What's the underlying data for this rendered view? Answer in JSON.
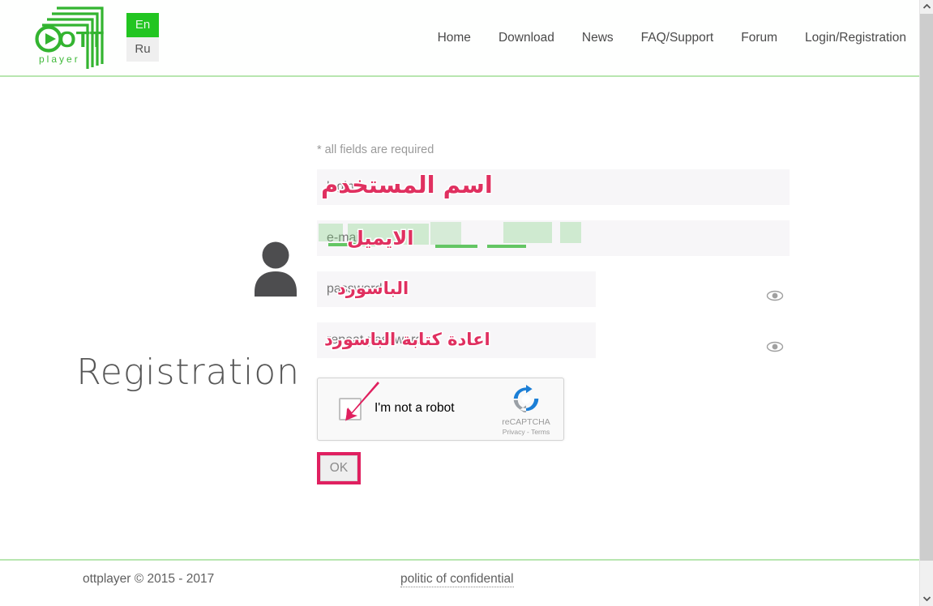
{
  "header": {
    "logo": {
      "name": "ottplayer-logo",
      "wordmark": "player",
      "letters": "OTT",
      "color": "#33b430"
    },
    "language_switcher": {
      "name": "language-switcher",
      "active": "En",
      "options": [
        "En",
        "Ru"
      ],
      "active_bg": "#22c521",
      "inactive_bg": "#efefef"
    },
    "nav": [
      {
        "label": "Home",
        "name": "nav-home"
      },
      {
        "label": "Download",
        "name": "nav-download"
      },
      {
        "label": "News",
        "name": "nav-news"
      },
      {
        "label": "FAQ/Support",
        "name": "nav-faq-support"
      },
      {
        "label": "Forum",
        "name": "nav-forum"
      },
      {
        "label": "Login/Registration",
        "name": "nav-login-registration"
      }
    ],
    "border_color": "#b8e6b0"
  },
  "main": {
    "page_title": "Registration",
    "avatar_icon": "user-avatar-icon",
    "required_note": "* all fields are required",
    "fields": [
      {
        "name": "username-input",
        "placeholder": "login",
        "value": "",
        "type": "text",
        "width": "wide",
        "annotation": "اسم المستخدم",
        "annotation_meaning": "username"
      },
      {
        "name": "email-input",
        "placeholder": "e-mail",
        "value": "",
        "type": "text",
        "width": "wide",
        "annotation": "الايميل",
        "annotation_meaning": "email"
      },
      {
        "name": "password-input",
        "placeholder": "password",
        "value": "",
        "type": "password",
        "width": "narrow",
        "annotation": "الباسورد",
        "annotation_meaning": "password",
        "toggle_icon": "eye-icon"
      },
      {
        "name": "repeat-password-input",
        "placeholder": "repeat password",
        "value": "",
        "type": "password",
        "width": "narrow",
        "annotation": "اعادة كتابة الباسورد",
        "annotation_meaning": "repeat password",
        "toggle_icon": "eye-icon"
      }
    ],
    "recaptcha": {
      "name": "recaptcha-widget",
      "label": "I'm not a robot",
      "brand": "reCAPTCHA",
      "terms": "Privacy - Terms",
      "checked": false,
      "arrow_annotation_color": "#e02060"
    },
    "submit": {
      "name": "ok-button",
      "label": "OK",
      "highlight_color": "#e02060"
    },
    "annotation_color": "#e03060",
    "highlight_color": "#3eba3e"
  },
  "footer": {
    "copyright": "ottplayer © 2015 - 2017",
    "policy_link": "politic of confidential"
  },
  "scrollbar": {
    "name": "vertical-scrollbar",
    "up_icon": "chevron-up-icon",
    "down_icon": "chevron-down-icon"
  }
}
